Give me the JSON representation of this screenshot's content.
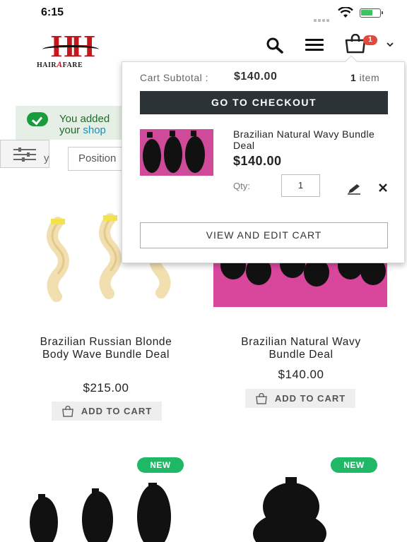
{
  "status_bar": {
    "time": "6:15"
  },
  "header": {
    "logo_text_left": "HAIR",
    "logo_text_mid": "A",
    "logo_text_right": "FARE",
    "cart_count": "1"
  },
  "message": {
    "line1": "You added",
    "line2_prefix": "your ",
    "line2_link": "shop"
  },
  "toolbar": {
    "sort_label": "y",
    "sort_value": "Position"
  },
  "products": [
    {
      "title": "Brazilian Russian Blonde Body Wave Bundle Deal",
      "price": "$215.00",
      "add_to_cart": "ADD TO CART"
    },
    {
      "title": "Brazilian Natural Wavy Bundle Deal",
      "price": "$140.00",
      "add_to_cart": "ADD TO CART"
    }
  ],
  "badges": {
    "new_left": "NEW",
    "new_right": "NEW"
  },
  "minicart": {
    "subtotal_label": "Cart Subtotal :",
    "subtotal_value": "$140.00",
    "count_number": "1",
    "count_suffix": " item",
    "checkout_label": "GO TO CHECKOUT",
    "item": {
      "name": "Brazilian Natural Wavy Bundle Deal",
      "price": "$140.00",
      "qty_label": "Qty:",
      "qty_value": "1"
    },
    "view_edit_label": "VIEW AND EDIT CART"
  },
  "colors": {
    "checkout_bg": "#2c3336",
    "new_badge": "#1fb866",
    "cart_badge": "#e04a3f",
    "success_bg": "#e5efe5",
    "logo_red": "#c4161c"
  },
  "icons": [
    "search-icon",
    "menu-icon",
    "cart-icon",
    "chevron-down-icon",
    "check-icon",
    "filter-icon",
    "bag-icon",
    "edit-icon",
    "close-icon"
  ]
}
